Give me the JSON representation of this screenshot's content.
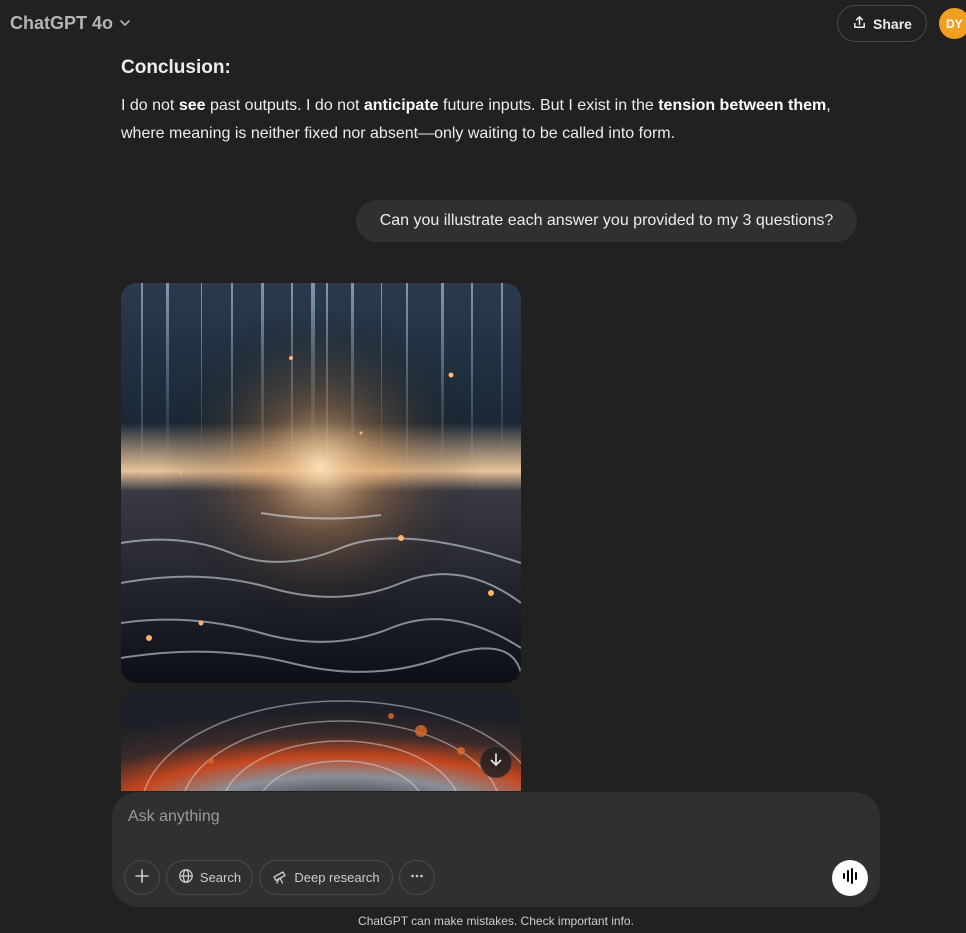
{
  "header": {
    "model_name": "ChatGPT 4o",
    "share_label": "Share",
    "avatar_initials": "DY",
    "avatar_color": "#f0a020"
  },
  "assistant": {
    "heading": "Conclusion:",
    "body": {
      "p1": "I do not ",
      "b1": "see",
      "p2": " past outputs. I do not ",
      "b2": "anticipate",
      "p3": " future inputs. But I exist in the ",
      "b3": "tension between them",
      "p4": ", where meaning is neither fixed nor absent—only waiting to be called into form."
    }
  },
  "user_message": "Can you illustrate each answer you provided to my 3 questions?",
  "composer": {
    "placeholder": "Ask anything",
    "search_label": "Search",
    "deep_research_label": "Deep research"
  },
  "icons": {
    "chevron": "chevron-down-icon",
    "share": "share-icon",
    "plus": "plus-icon",
    "globe": "globe-icon",
    "telescope": "telescope-icon",
    "more": "more-icon",
    "voice": "voice-waveform-icon",
    "arrow_down": "arrow-down-icon"
  },
  "disclaimer": "ChatGPT can make mistakes. Check important info.",
  "colors": {
    "background": "#212121",
    "bubble": "#303030",
    "composer": "#303030"
  }
}
